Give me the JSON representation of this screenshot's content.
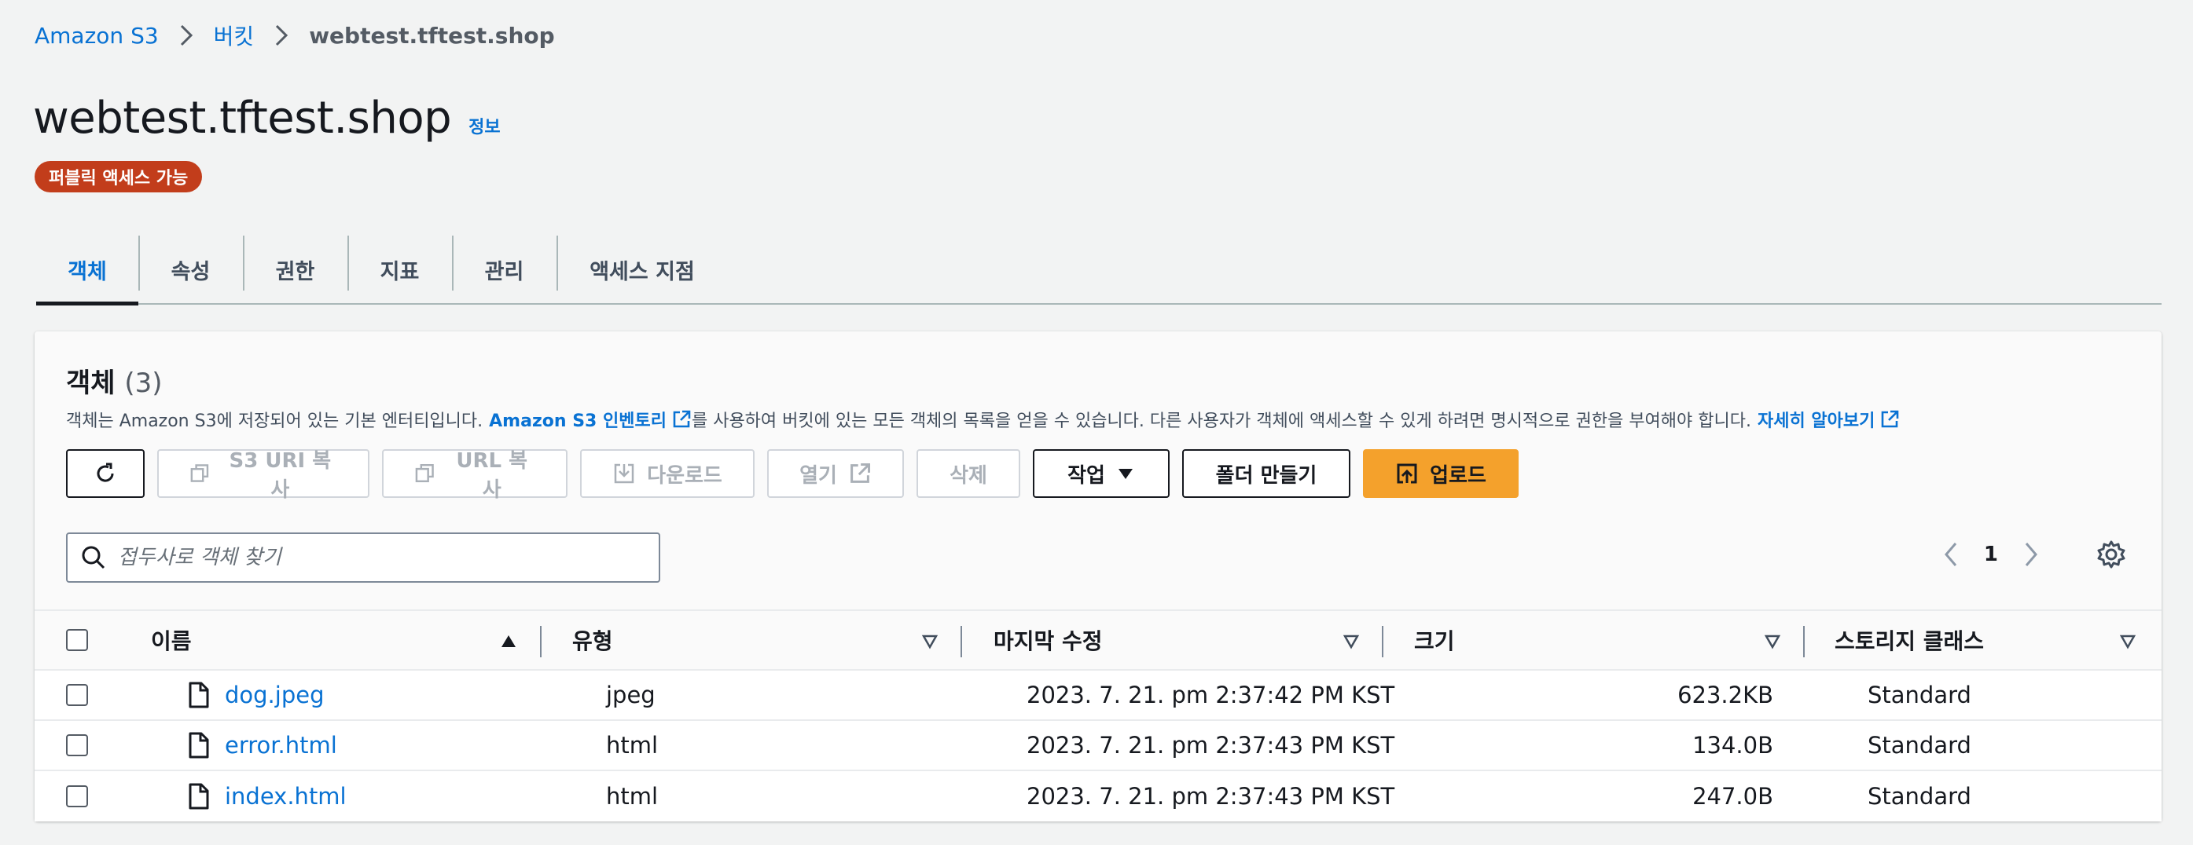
{
  "breadcrumb": {
    "items": [
      "Amazon S3",
      "버킷",
      "webtest.tftest.shop"
    ]
  },
  "page": {
    "title": "webtest.tftest.shop",
    "info_link": "정보",
    "badge": "퍼블릭 액세스 가능"
  },
  "tabs": [
    "객체",
    "속성",
    "권한",
    "지표",
    "관리",
    "액세스 지점"
  ],
  "objects": {
    "heading": "객체",
    "count": "(3)",
    "desc_prefix": "객체는 Amazon S3에 저장되어 있는 기본 엔터티입니다.",
    "desc_link": "Amazon S3 인벤토리",
    "desc_middle": "를 사용하여 버킷에 있는 모든 객체의 목록을 얻을 수 있습니다. 다른 사용자가 객체에 액세스할 수 있게 하려면 명시적으로 권한을 부여해야 합니다.",
    "desc_learn_more": "자세히 알아보기"
  },
  "toolbar": {
    "copy_s3_uri": "S3 URI 복사",
    "copy_url": "URL 복사",
    "download": "다운로드",
    "open": "열기",
    "delete": "삭제",
    "actions": "작업",
    "create_folder": "폴더 만들기",
    "upload": "업로드"
  },
  "search": {
    "placeholder": "접두사로 객체 찾기"
  },
  "pagination": {
    "page": "1"
  },
  "table": {
    "columns": [
      "이름",
      "유형",
      "마지막 수정",
      "크기",
      "스토리지 클래스"
    ],
    "rows": [
      {
        "name": "dog.jpeg",
        "type": "jpeg",
        "modified": "2023. 7. 21. pm 2:37:42 PM KST",
        "size": "623.2KB",
        "class": "Standard"
      },
      {
        "name": "error.html",
        "type": "html",
        "modified": "2023. 7. 21. pm 2:37:43 PM KST",
        "size": "134.0B",
        "class": "Standard"
      },
      {
        "name": "index.html",
        "type": "html",
        "modified": "2023. 7. 21. pm 2:37:43 PM KST",
        "size": "247.0B",
        "class": "Standard"
      }
    ]
  },
  "colors": {
    "link": "#0972d3",
    "badge": "#c23d1b",
    "primary_button": "#f4a12c",
    "background": "#f2f3f3"
  }
}
